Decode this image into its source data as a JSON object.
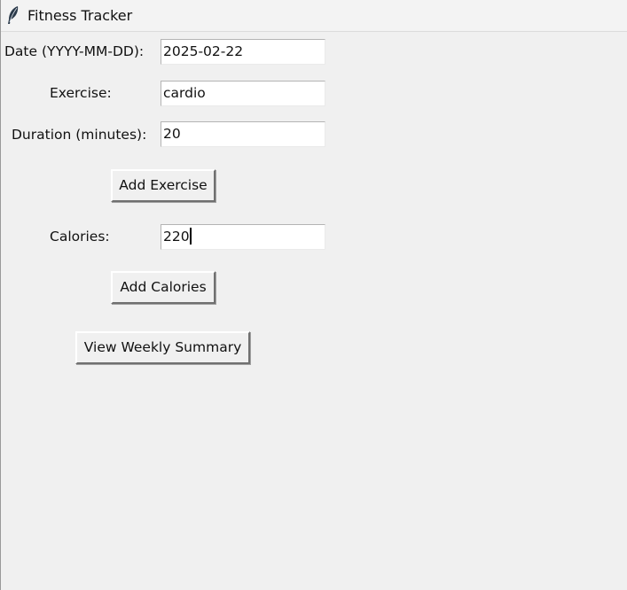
{
  "window": {
    "title": "Fitness Tracker",
    "icon": "feather-icon"
  },
  "form": {
    "date_label": "Date (YYYY-MM-DD):",
    "date_value": "2025-02-22",
    "exercise_label": "Exercise:",
    "exercise_value": "cardio",
    "duration_label": "Duration (minutes):",
    "duration_value": "20",
    "add_exercise_label": "Add Exercise",
    "calories_label": "Calories:",
    "calories_value": "220",
    "add_calories_label": "Add Calories",
    "weekly_summary_label": "View Weekly Summary"
  }
}
